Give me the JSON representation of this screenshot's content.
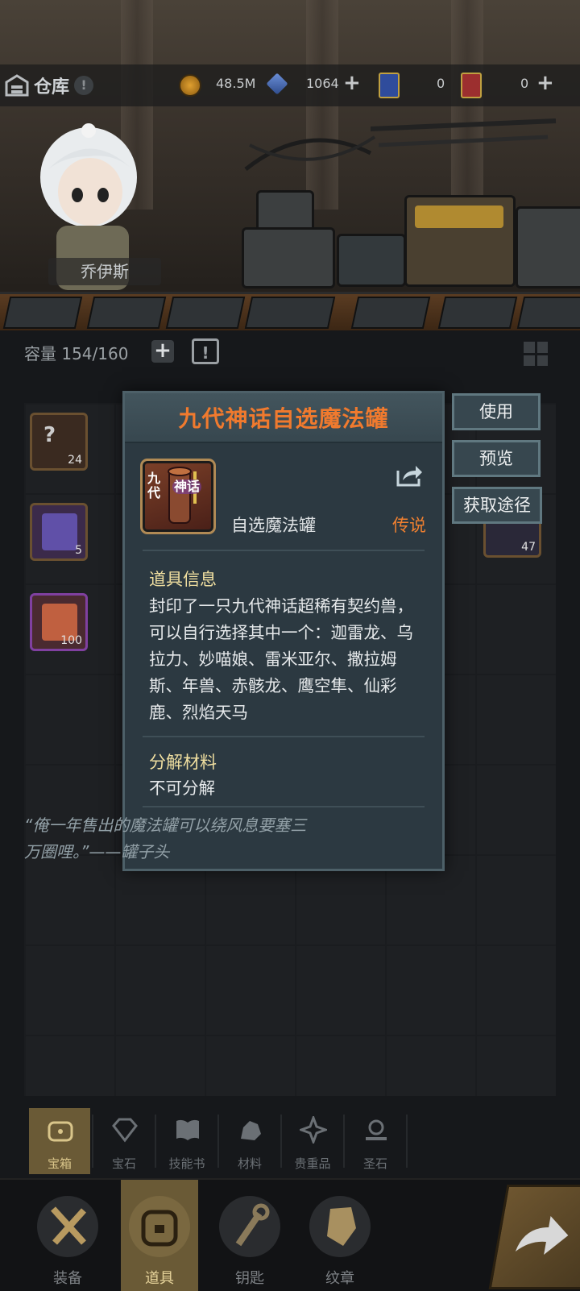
{
  "topbar": {
    "title": "仓库",
    "gold": "48.5M",
    "crystal": "1064",
    "ticket_a": "0",
    "ticket_b": "0"
  },
  "hero": {
    "name": "乔伊斯"
  },
  "inventory": {
    "capacity_label": "容量",
    "capacity_value": "154/160",
    "items": [
      {
        "count": "24"
      },
      {
        "count": "5"
      },
      {
        "count": "100"
      },
      {
        "count": "47"
      }
    ]
  },
  "modal": {
    "title": "九代神话自选魔法罐",
    "icon_text_1": "九代",
    "icon_text_2": "神话",
    "item_name": "自选魔法罐",
    "rarity": "传说",
    "info_title": "道具信息",
    "info_body": "封印了一只九代神话超稀有契约兽，可以自行选择其中一个：迦雷龙、乌拉力、妙喵娘、雷米亚尔、撒拉姆斯、年兽、赤骸龙、鹰空隼、仙彩鹿、烈焰天马",
    "decompose_title": "分解材料",
    "decompose_body": "不可分解",
    "quote": "“俺一年售出的魔法罐可以绕风息要塞三万圈哩。”——罐子头"
  },
  "actions": {
    "use": "使用",
    "preview": "预览",
    "source": "获取途径"
  },
  "categories": [
    "宝箱",
    "宝石",
    "技能书",
    "材料",
    "贵重品",
    "圣石"
  ],
  "nav": [
    "装备",
    "道具",
    "钥匙",
    "纹章"
  ]
}
